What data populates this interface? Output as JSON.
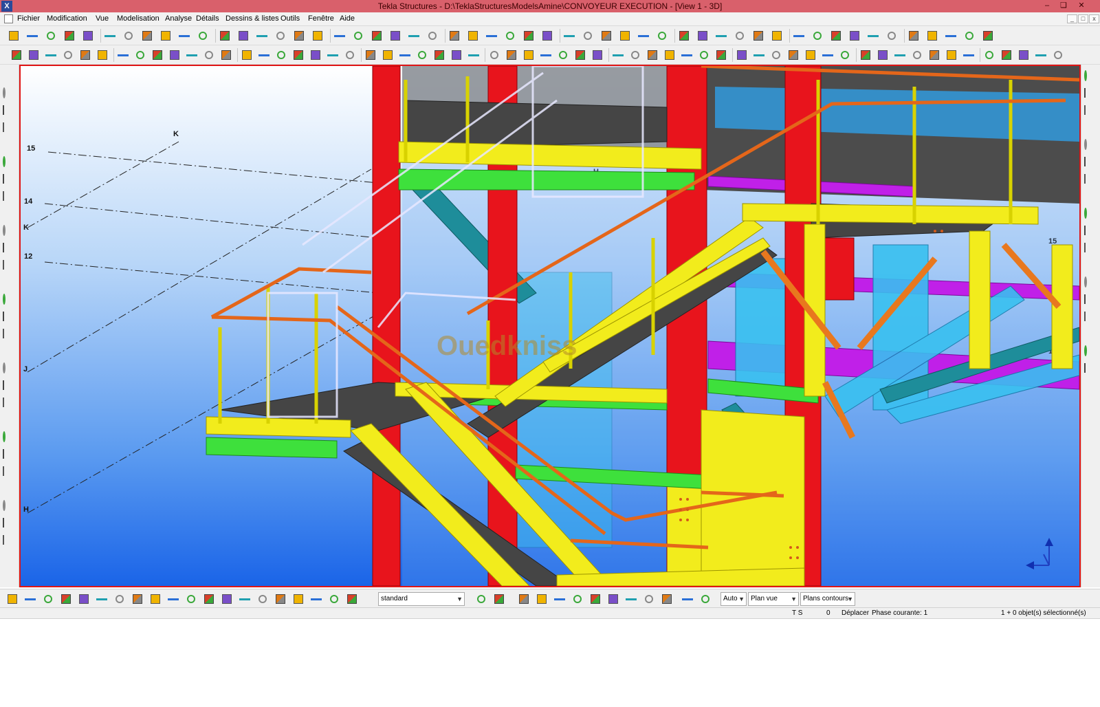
{
  "window": {
    "title": "Tekla Structures - D:\\TeklaStructuresModelsAmine\\CONVOYEUR EXECUTION - [View 1 - 3D]",
    "app_icon": "X",
    "controls": {
      "minimize": "–",
      "restore": "❏",
      "close": "✕"
    }
  },
  "menubar": {
    "items": [
      "Fichier",
      "Modification",
      "Vue",
      "Modelisation",
      "Analyse",
      "Détails",
      "Dessins & listes",
      "Outils",
      "Fenêtre",
      "Aide"
    ]
  },
  "toolbar": {
    "view_filter": "standard",
    "work_plane_mode": "Auto",
    "view_plane": "Plan vue",
    "contour_planes": "Plans contours"
  },
  "viewport": {
    "grid_labels": [
      "15",
      "K",
      "14",
      "K",
      "12",
      "J",
      "H",
      "J",
      "H",
      "15",
      "15",
      "12"
    ],
    "watermark": "Ouedkniss",
    "colors": {
      "frame_border": "#e01515",
      "column": "#e8141c",
      "stair_member": "#f2ec1c",
      "handrail": "#e4661a",
      "beam_green": "#3ee03c",
      "beam_teal": "#1e8d9a",
      "beam_magenta": "#c020e8",
      "beam_cyan": "#38c0f0",
      "grating": "#4a4a4a",
      "brace_orange": "#e8781e"
    }
  },
  "statusbar": {
    "mode": "T S",
    "counter": "0",
    "command": "Déplacer",
    "phase": "Phase courante: 1",
    "selection": "1 + 0 objet(s) sélectionné(s)"
  }
}
